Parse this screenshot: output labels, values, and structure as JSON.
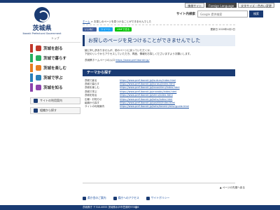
{
  "header": {
    "util_buttons": [
      "携帯サイト",
      "Foreign Language",
      "文字サイズ・色合い変更"
    ],
    "logo_name": "茨城県",
    "logo_sub": "Ibaraki Prefectural Government",
    "search_label": "サイト内検索",
    "search_placeholder": "Google 提供検索",
    "search_button": "検索"
  },
  "sidebar": {
    "top_link": "トップ",
    "items": [
      {
        "label": "茨城を創る",
        "color": "#c0392b"
      },
      {
        "label": "茨城で暮らす",
        "color": "#27ae60"
      },
      {
        "label": "茨城を楽しむ",
        "color": "#e67e22"
      },
      {
        "label": "茨城で学ぶ",
        "color": "#2980b9"
      },
      {
        "label": "茨城を知る",
        "color": "#8e44ad"
      }
    ],
    "sub_links": [
      "サイトの利用案内",
      "組織から探す"
    ]
  },
  "main": {
    "breadcrumb_home": "ホーム",
    "breadcrumb_current": "お探しのページを見つけることができませんでした",
    "share_buttons": [
      "いいね！",
      "ツイート",
      "LINEで送る"
    ],
    "update_date": "更新日 2020年4月1日",
    "title": "お探しのページを見つけることができませんでした",
    "message_line1": "誠に申し訳ありませんが、前のページに戻っていただくか、",
    "message_line2": "下記のリンクからアクセスしていただき、再度、情報をお探しくださいますようお願いします。",
    "home_text": "茨城県ホームページの入口",
    "home_url": "https://www.pref.ibaraki.jp/",
    "theme_heading": "テーマから探す",
    "themes": [
      {
        "label": "茨城で創る",
        "url": "https://www.pref.ibaraki.jp/tsukuru/index.html"
      },
      {
        "label": "茨城で暮らす",
        "url": "https://www.pref.ibaraki.jp/kurasu/index.html"
      },
      {
        "label": "茨城を楽しむ",
        "url": "https://www.pref.ibaraki.jp/tanoshimu/index.html"
      },
      {
        "label": "茨城で学ぶ",
        "url": "https://www.pref.ibaraki.jp/manabu/index.html"
      },
      {
        "label": "茨城を知る",
        "url": "https://www.pref.ibaraki.jp/shiru/index.html"
      },
      {
        "label": "広報・お知らせ",
        "url": "https://www.pref.ibaraki.jp/koho/index.html"
      },
      {
        "label": "組織から探す",
        "url": "https://www.pref.ibaraki.jp/soshiki/index.html"
      },
      {
        "label": "サイトの利用案内",
        "url": "https://www.pref.ibaraki.jp/koho/kenmin/misc/guide.html"
      }
    ],
    "page_top": "▲ ページの先頭へ戻る"
  },
  "footer": {
    "links": [
      "県庁舎のご案内",
      "県庁へのアクセス",
      "サイトポリシー"
    ],
    "bottom_text": "茨城県庁 〒310-8555 茨城県水戸市笠原町978番6"
  },
  "colors": {
    "brand": "#1a3b73",
    "facebook": "#3b5998",
    "twitter": "#1da1f2",
    "line": "#00c300"
  }
}
